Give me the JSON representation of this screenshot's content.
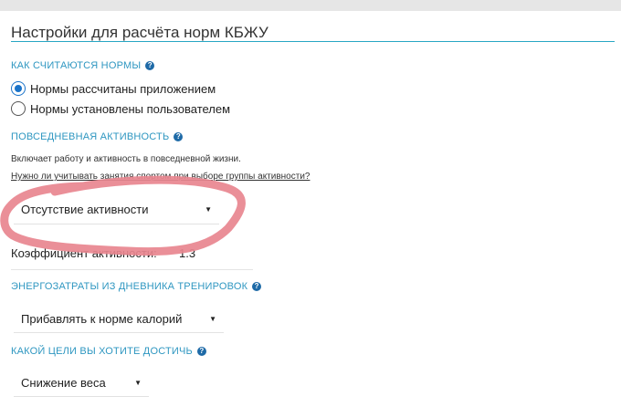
{
  "panel": {
    "title": "Настройки для расчёта норм КБЖУ"
  },
  "norms_section": {
    "heading": "Как считаются нормы",
    "options": [
      {
        "label": "Нормы рассчитаны приложением",
        "checked": true
      },
      {
        "label": "Нормы установлены пользователем",
        "checked": false
      }
    ]
  },
  "activity_section": {
    "heading": "Повседневная активность",
    "description": "Включает работу и активность в повседневной жизни.",
    "link_text": "Нужно ли учитывать занятия спортом при выборе группы активности?",
    "select_value": "Отсутствие активности",
    "coefficient_label": "Коэффициент активности:",
    "coefficient_value": "1.3"
  },
  "training_section": {
    "heading": "Энергозатраты из дневника тренировок",
    "select_value": "Прибавлять к норме калорий"
  },
  "goal_section": {
    "heading": "Какой цели вы хотите достичь",
    "select_value": "Снижение веса"
  },
  "colors": {
    "accent": "#2f97c1",
    "title_rule": "#28a6c4",
    "help_icon": "#1e6aa7",
    "annotation": "#e8868f"
  },
  "icons": {
    "help": "question-circle-icon",
    "dropdown": "caret-down-icon"
  }
}
